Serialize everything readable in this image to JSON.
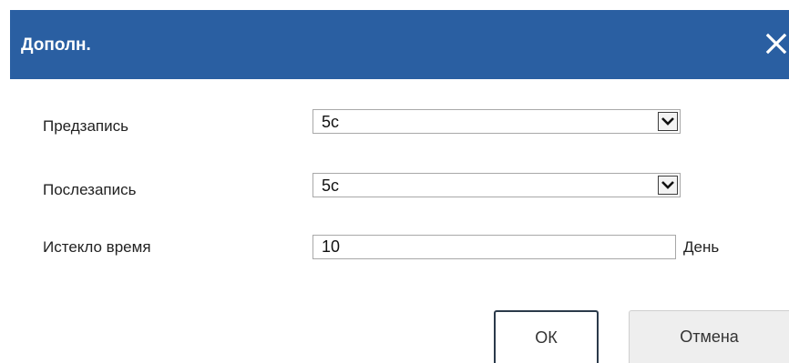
{
  "dialog": {
    "title": "Дополн.",
    "close_icon": "close-icon"
  },
  "form": {
    "prerecord": {
      "label": "Предзапись",
      "value": "5с"
    },
    "postrecord": {
      "label": "Послезапись",
      "value": "5с"
    },
    "expire": {
      "label": "Истекло время",
      "value": "10",
      "unit": "День"
    }
  },
  "buttons": {
    "ok_label": "ОК",
    "cancel_label": "Отмена"
  },
  "colors": {
    "titlebar": "#2a5fa2",
    "title_text": "#ffffff",
    "ok_border": "#2b3a4a",
    "cancel_bg": "#eeeeee"
  }
}
